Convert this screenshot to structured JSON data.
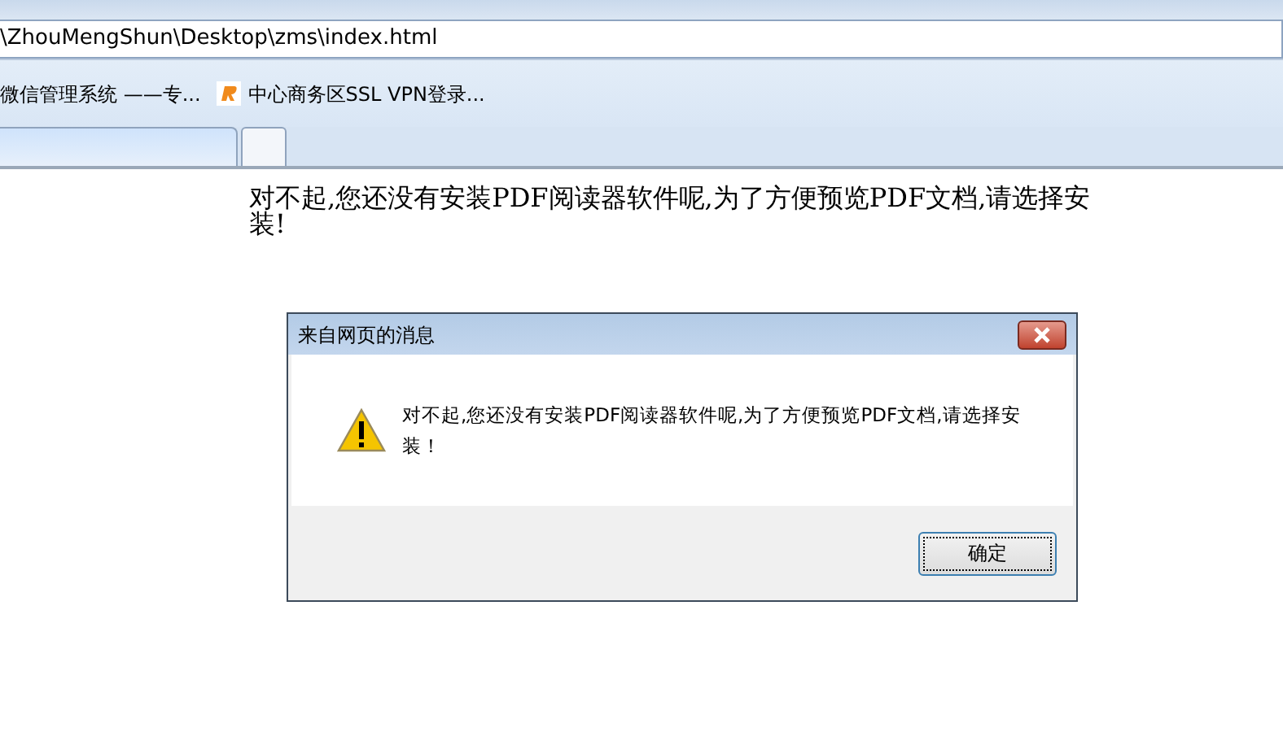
{
  "address_bar": {
    "value": "\\ZhouMengShun\\Desktop\\zms\\index.html"
  },
  "favorites": [
    {
      "kind": "plain",
      "label": "微信管理系统 ——专..."
    },
    {
      "kind": "logo",
      "label": "中心商务区SSL VPN登录..."
    }
  ],
  "tabs": [
    {
      "selected": true
    },
    {
      "selected": false
    }
  ],
  "page": {
    "text": "对不起,您还没有安装PDF阅读器软件呢,为了方便预览PDF文档,请选择安装!"
  },
  "dialog": {
    "title": "来自网页的消息",
    "message": "对不起,您还没有安装PDF阅读器软件呢,为了方便预览PDF文档,请选择安装！",
    "buttons": [
      {
        "label": "确定",
        "focused": true
      }
    ]
  }
}
